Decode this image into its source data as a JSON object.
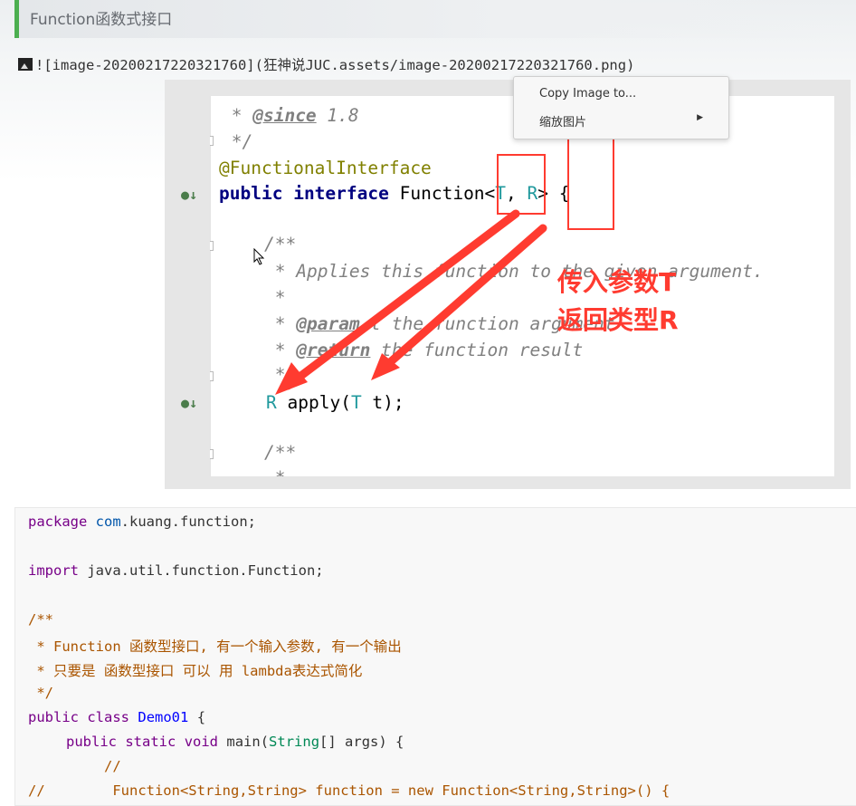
{
  "heading": {
    "title": "Function函数式接口"
  },
  "image_ref": {
    "text": "![image-20200217220321760](狂神说JUC.assets/image-20200217220321760.png)"
  },
  "editor": {
    "line1": {
      "prefix": " * ",
      "tag": "@since",
      "rest": " 1.8"
    },
    "line2": " */",
    "line3": "@FunctionalInterface",
    "line4": {
      "kw1": "public",
      "kw2": "interface",
      "name": "Function<",
      "t": "T",
      "comma": ", ",
      "r": "R",
      "rest": "> {"
    },
    "line5": "/**",
    "line6": " * Applies this function to the given argument.",
    "line7": " *",
    "line8": {
      "prefix": " * ",
      "tag": "@param",
      "rest": " t the function argument"
    },
    "line9": {
      "prefix": " * ",
      "tag": "@return",
      "rest": " the function result"
    },
    "line10": " */",
    "line11": {
      "r": "R",
      "mid": " apply(",
      "t": "T",
      "rest": " t);"
    },
    "line12": "/**",
    "line13": " * ",
    "annotation_line1": "传入参数T",
    "annotation_line2": "返回类型R"
  },
  "context_menu": {
    "items": [
      "Copy Image to...",
      "缩放图片"
    ]
  },
  "code": {
    "l1": {
      "kw": "package",
      "a": " ",
      "b": "com",
      "c": ".kuang.function;"
    },
    "l2": {
      "kw": "import",
      "rest": " java.util.function.Function;"
    },
    "l3": "/**",
    "l4": " * Function 函数型接口, 有一个输入参数, 有一个输出",
    "l5": " * 只要是 函数型接口 可以 用 lambda表达式简化",
    "l6": " */",
    "l7": {
      "kw1": "public",
      "kw2": "class",
      "name": "Demo01",
      "rest": " {"
    },
    "l8": {
      "kw1": "public",
      "kw2": "static",
      "kw3": "void",
      "name": "main",
      "p1": "(",
      "type": "String",
      "rest": "[] args) {"
    },
    "l9": "//",
    "l10": "//        Function<String,String> function = new Function<String,String>() {"
  }
}
